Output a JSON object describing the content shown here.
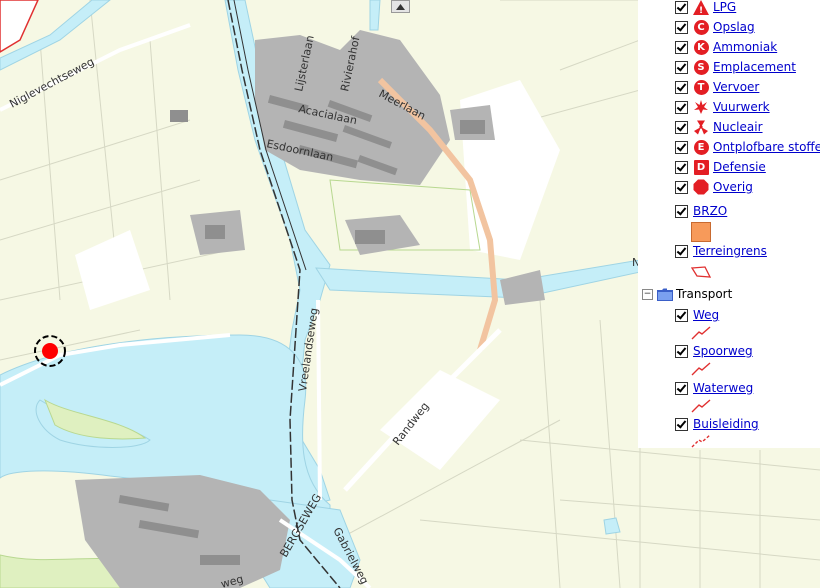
{
  "map": {
    "streets": {
      "niglevechtseweg": "Niglevechtseweg",
      "lijsterlaan": "Lijsterlaan",
      "rivierahof": "Rivierahof",
      "meerlaan": "Meerlaan",
      "acacialaan": "Acacialaan",
      "esdoornlaan": "Esdoornlaan",
      "vreelandseweg": "Vreelandseweg",
      "randweg": "Randweg",
      "bergseweg": "BERGSEWEG",
      "gabrielweg": "Gabrielweg",
      "weg_bottom": "weg",
      "n_label": "N"
    },
    "colors": {
      "land": "#f6f8e4",
      "water": "#c5eef8",
      "built": "#b4b4b4",
      "buildings": "#8f8f8f",
      "main_road": "#f2c4a0",
      "marker": "#ff0000"
    }
  },
  "legend": {
    "risk_items": [
      {
        "label": "LPG",
        "icon": "lpg-warning-icon",
        "letter": "!"
      },
      {
        "label": "Opslag",
        "icon": "opslag-icon",
        "letter": "C"
      },
      {
        "label": "Ammoniak",
        "icon": "ammoniak-icon",
        "letter": "K"
      },
      {
        "label": "Emplacement",
        "icon": "emplacement-icon",
        "letter": "S"
      },
      {
        "label": "Vervoer",
        "icon": "vervoer-icon",
        "letter": "T"
      },
      {
        "label": "Vuurwerk",
        "icon": "vuurwerk-icon",
        "letter": ""
      },
      {
        "label": "Nucleair",
        "icon": "nucleair-icon",
        "letter": ""
      },
      {
        "label": "Ontplofbare stoffen",
        "icon": "ontplofbare-stoffen-icon",
        "letter": "E"
      },
      {
        "label": "Defensie",
        "icon": "defensie-icon",
        "letter": "D"
      },
      {
        "label": "Overig",
        "icon": "overig-icon",
        "letter": ""
      }
    ],
    "brzo": {
      "label": "BRZO",
      "color": "#f79a5a"
    },
    "terreingrens": {
      "label": "Terreingrens"
    },
    "transport": {
      "label": "Transport",
      "items": [
        {
          "label": "Weg"
        },
        {
          "label": "Spoorweg"
        },
        {
          "label": "Waterweg"
        },
        {
          "label": "Buisleiding"
        }
      ]
    }
  }
}
